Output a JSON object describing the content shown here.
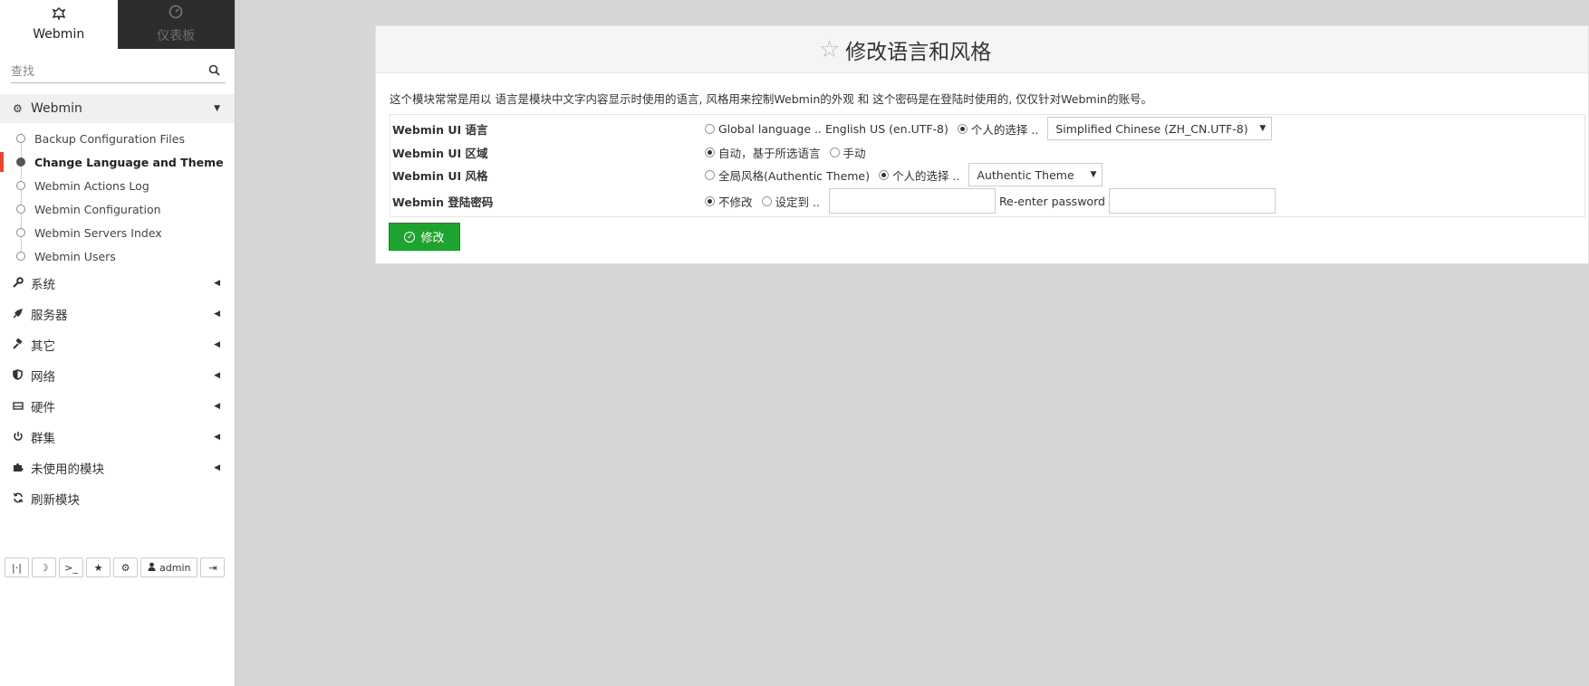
{
  "sidebar": {
    "tabs": [
      {
        "label": "Webmin",
        "icon": "webmin-logo-icon"
      },
      {
        "label": "仪表板",
        "icon": "dashboard-icon"
      }
    ],
    "search_placeholder": "查找",
    "open_group": {
      "label": "Webmin",
      "items": [
        "Backup Configuration Files",
        "Change Language and Theme",
        "Webmin Actions Log",
        "Webmin Configuration",
        "Webmin Servers Index",
        "Webmin Users"
      ],
      "active_index": 1
    },
    "categories": [
      {
        "label": "系统",
        "icon": "wrench-icon"
      },
      {
        "label": "服务器",
        "icon": "rocket-icon"
      },
      {
        "label": "其它",
        "icon": "gavel-icon"
      },
      {
        "label": "网络",
        "icon": "shield-icon"
      },
      {
        "label": "硬件",
        "icon": "hdd-icon"
      },
      {
        "label": "群集",
        "icon": "power-icon"
      },
      {
        "label": "未使用的模块",
        "icon": "puzzle-icon"
      },
      {
        "label": "刷新模块",
        "icon": "refresh-icon"
      }
    ],
    "toolbar_user": "admin",
    "accent_color": "#e8472e"
  },
  "main": {
    "title": "修改语言和风格",
    "description": "这个模块常常是用以 语言是模块中文字内容显示时使用的语言, 风格用来控制Webmin的外观 和 这个密码是在登陆时使用的, 仅仅针对Webmin的账号。",
    "rows": {
      "language": {
        "label": "Webmin UI 语言",
        "global_option": "Global language .. English US (en.UTF-8)",
        "personal_option": "个人的选择 ..",
        "selected_value": "Simplified Chinese (ZH_CN.UTF-8)"
      },
      "locale": {
        "label": "Webmin UI 区域",
        "auto_option": "自动，基于所选语言",
        "manual_option": "手动"
      },
      "theme": {
        "label": "Webmin UI 风格",
        "global_option": "全局风格(Authentic Theme)",
        "personal_option": "个人的选择 ..",
        "selected_value": "Authentic Theme"
      },
      "password": {
        "label": "Webmin 登陆密码",
        "nochange_option": "不修改",
        "set_option": "设定到 ..",
        "reenter_label": "Re-enter password"
      }
    },
    "save_label": "修改",
    "save_color": "#1ea42e"
  }
}
